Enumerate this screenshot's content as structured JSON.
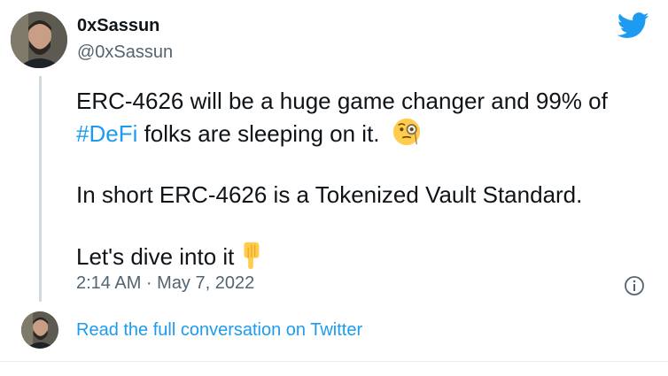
{
  "tweet": {
    "display_name": "0xSassun",
    "handle": "@0xSassun",
    "line1": "ERC-4626 will be a huge game changer and 99% of",
    "hashtag": "#DeFi",
    "line2_rest": " folks are sleeping on it.",
    "paragraph2": "In short ERC-4626 is a Tokenized Vault Standard.",
    "paragraph3": "Let's dive into it",
    "timestamp": "2:14 AM · May 7, 2022"
  },
  "footer": {
    "read_conversation": "Read the full conversation on Twitter"
  },
  "icons": {
    "brand": "twitter-bird-icon",
    "info": "info-icon",
    "emoji_1": "face-with-monocle-emoji",
    "emoji_2": "pointing-down-emoji"
  },
  "colors": {
    "accent": "#1d9bf0",
    "muted": "#536471",
    "text": "#0f1419",
    "thread_line": "#cfd9de"
  }
}
